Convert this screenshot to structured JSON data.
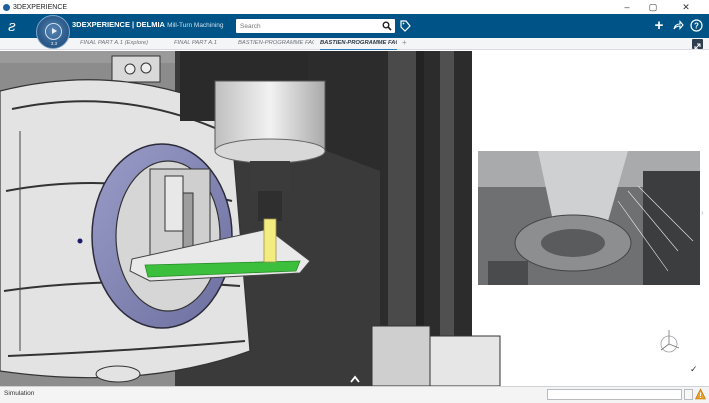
{
  "window": {
    "title": "3DEXPERIENCE",
    "minimize_glyph": "–",
    "maximize_glyph": "▢",
    "close_glyph": "✕"
  },
  "compass": {
    "version": "3.3"
  },
  "header": {
    "brand_prefix": "3D",
    "brand_name": "EXPERIENCE | DELMIA",
    "app_name": "Mill-Turn Machining"
  },
  "search": {
    "placeholder": "Search",
    "value": ""
  },
  "toolbar": {
    "add_glyph": "+",
    "share_glyph": "⮣",
    "help_glyph": "?"
  },
  "tabs": [
    {
      "label": "FINAL PART A.1 (Explore)",
      "active": false
    },
    {
      "label": "FINAL PART A.1",
      "active": false
    },
    {
      "label": "BASTIEN-PROGRAMME FACE",
      "active": false
    },
    {
      "label": "BASTIEN-PROGRAMME FACE",
      "active": true
    }
  ],
  "tab_add": "+",
  "status": {
    "text": "Simulation"
  },
  "viewport": {
    "check_glyph": "✓",
    "side_arrow_glyph": "›"
  },
  "colors": {
    "header_blue": "#005386",
    "tab_underline": "#2e7fc1",
    "part_green": "#3cbf3c",
    "tool_yellow": "#f3ec7e",
    "fixture_purple": "#7e80b0",
    "warning_orange": "#f0a020"
  }
}
